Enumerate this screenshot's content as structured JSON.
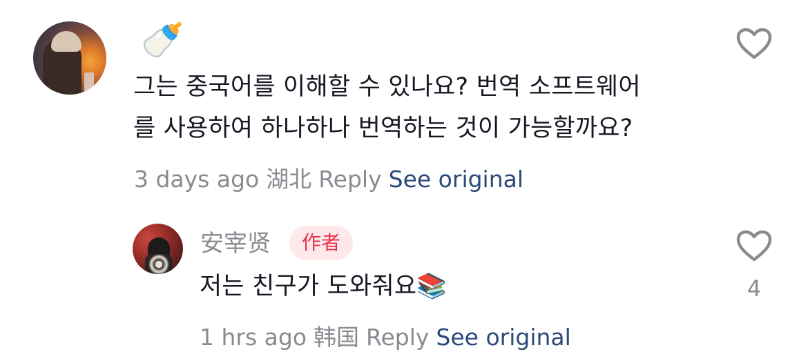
{
  "comment": {
    "emoji": "🍼",
    "text_line1": "그는 중국어를 이해할 수 있나요? 번역 소프트웨어",
    "text_line2": "를 사용하여 하나하나 번역하는 것이 가능할까요?",
    "meta": {
      "time": "3 days ago",
      "location": "湖北",
      "reply_label": "Reply",
      "see_original_label": "See original"
    },
    "like_icon": "heart-outline-icon"
  },
  "reply": {
    "username": "安宰贤",
    "badge": "作者",
    "text": "저는 친구가 도와줘요",
    "emoji": "📚",
    "meta": {
      "time": "1 hrs ago",
      "location": "韩国",
      "reply_label": "Reply",
      "see_original_label": "See original"
    },
    "like_icon": "heart-outline-icon",
    "like_count": "4"
  },
  "colors": {
    "text_primary": "#161823",
    "text_secondary": "#8a8b91",
    "link": "#2b4a7a",
    "badge_bg": "#fde8ea",
    "badge_text": "#e5334b"
  }
}
